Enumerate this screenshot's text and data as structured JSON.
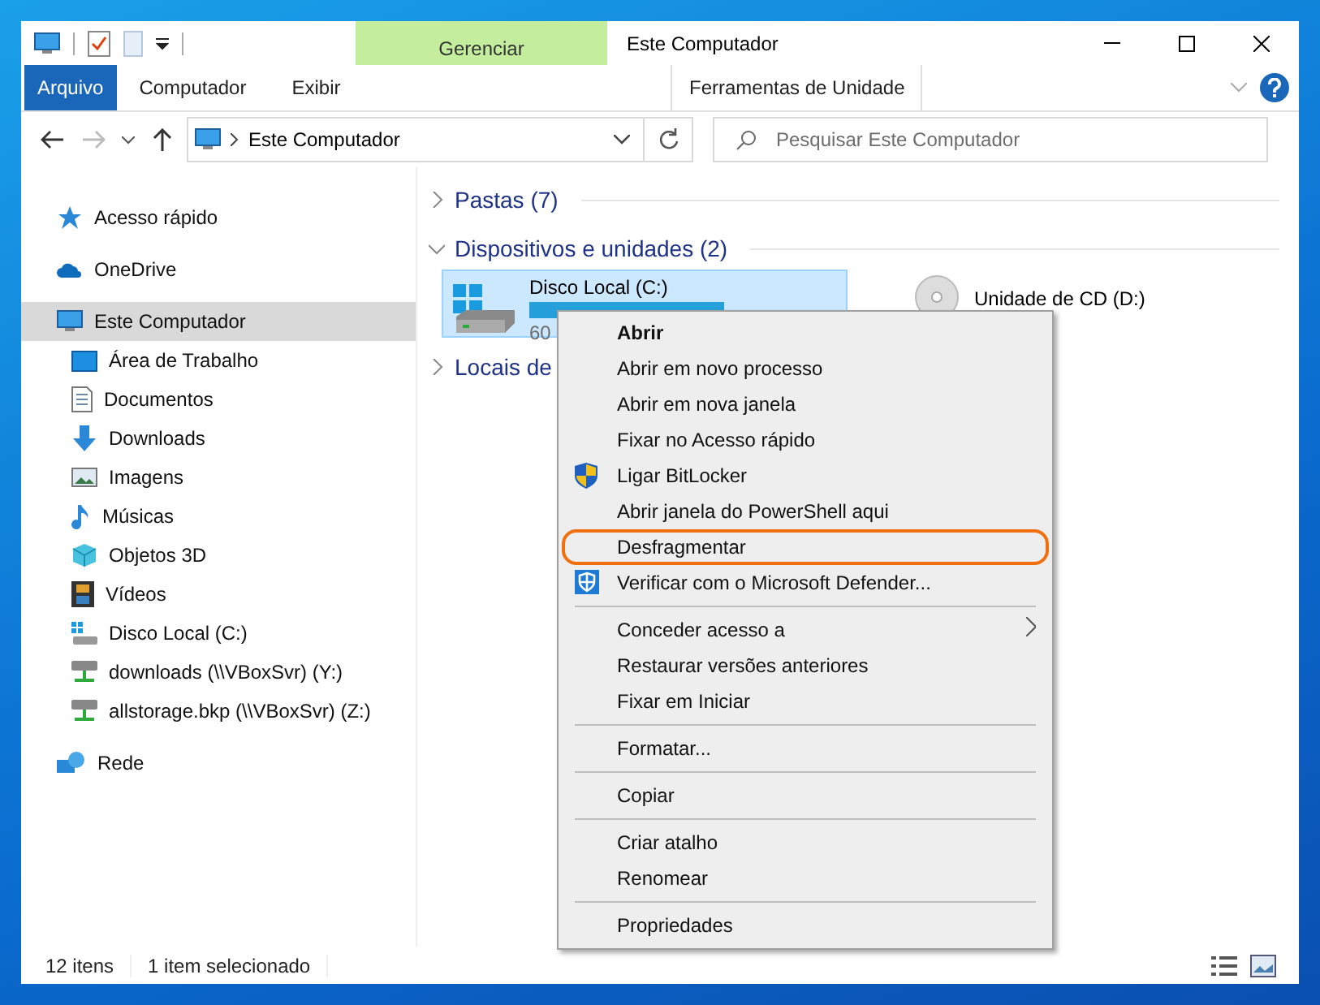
{
  "window": {
    "title": "Este Computador",
    "contextual_group": "Gerenciar"
  },
  "ribbon_tabs": [
    {
      "label": "Arquivo",
      "kind": "file"
    },
    {
      "label": "Computador",
      "kind": "tab"
    },
    {
      "label": "Exibir",
      "kind": "tab"
    },
    {
      "label": "Ferramentas de Unidade",
      "kind": "contextual"
    }
  ],
  "navigation": {
    "back_disabled": false,
    "forward_disabled": true
  },
  "address_bar": {
    "path": "Este Computador"
  },
  "search": {
    "placeholder": "Pesquisar Este Computador"
  },
  "sidebar": {
    "items": [
      {
        "label": "Acesso rápido",
        "selected": false
      },
      {
        "label": "OneDrive",
        "selected": false
      },
      {
        "label": "Este Computador",
        "selected": true,
        "children": [
          {
            "label": "Área de Trabalho",
            "selected": false
          },
          {
            "label": "Documentos",
            "selected": false
          },
          {
            "label": "Downloads",
            "selected": false
          },
          {
            "label": "Imagens",
            "selected": false
          },
          {
            "label": "Músicas",
            "selected": false
          },
          {
            "label": "Objetos 3D",
            "selected": false
          },
          {
            "label": "Vídeos",
            "selected": false
          },
          {
            "label": "Disco Local (C:)",
            "selected": false
          },
          {
            "label": "downloads (\\\\VBoxSvr) (Y:)",
            "selected": false
          },
          {
            "label": "allstorage.bkp (\\\\VBoxSvr) (Z:)",
            "selected": false
          }
        ]
      },
      {
        "label": "Rede",
        "selected": false
      }
    ]
  },
  "groups": [
    {
      "label": "Pastas (7)",
      "expanded": false
    },
    {
      "label": "Dispositivos e unidades (2)",
      "expanded": true,
      "drives": [
        {
          "name": "Disco Local (C:)",
          "detail": "60",
          "selected": true
        },
        {
          "name": "Unidade de CD (D:)",
          "selected": false
        }
      ]
    },
    {
      "label": "Locais de",
      "expanded": false
    }
  ],
  "context_menu": {
    "items": [
      {
        "kind": "item",
        "label": "Abrir",
        "default": true
      },
      {
        "kind": "item",
        "label": "Abrir em novo processo"
      },
      {
        "kind": "item",
        "label": "Abrir em nova janela"
      },
      {
        "kind": "item",
        "label": "Fixar no Acesso rápido"
      },
      {
        "kind": "item",
        "label": "Ligar BitLocker"
      },
      {
        "kind": "item",
        "label": "Abrir janela do PowerShell aqui"
      },
      {
        "kind": "item",
        "label": "Desfragmentar",
        "highlighted": true
      },
      {
        "kind": "item",
        "label": "Verificar com o Microsoft Defender..."
      },
      {
        "kind": "separator"
      },
      {
        "kind": "item",
        "label": "Conceder acesso a",
        "submenu": true
      },
      {
        "kind": "item",
        "label": "Restaurar versões anteriores"
      },
      {
        "kind": "item",
        "label": "Fixar em Iniciar"
      },
      {
        "kind": "separator"
      },
      {
        "kind": "item",
        "label": "Formatar..."
      },
      {
        "kind": "separator"
      },
      {
        "kind": "item",
        "label": "Copiar"
      },
      {
        "kind": "separator"
      },
      {
        "kind": "item",
        "label": "Criar atalho"
      },
      {
        "kind": "item",
        "label": "Renomear"
      },
      {
        "kind": "separator"
      },
      {
        "kind": "item",
        "label": "Propriedades"
      }
    ]
  },
  "status_bar": {
    "item_count": "12 itens",
    "selection": "1 item selecionado"
  }
}
